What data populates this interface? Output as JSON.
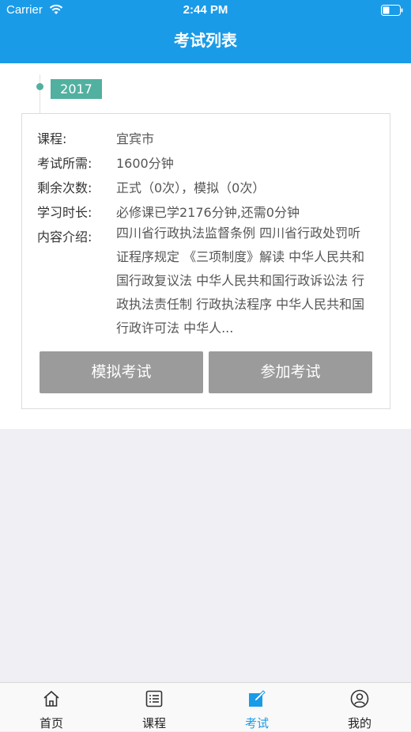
{
  "status_bar": {
    "carrier": "Carrier",
    "time": "2:44 PM"
  },
  "nav": {
    "title": "考试列表"
  },
  "timeline": {
    "year": "2017"
  },
  "exam": {
    "course_label": "课程:",
    "course_value": "宜宾市",
    "duration_label": "考试所需:",
    "duration_value": "1600分钟",
    "attempts_label": "剩余次数:",
    "attempts_value": "正式（0次），模拟（0次）",
    "study_label": "学习时长:",
    "study_value": "必修课已学2176分钟,还需0分钟",
    "intro_label": "内容介绍:",
    "intro_value": "四川省行政执法监督条例 四川省行政处罚听证程序规定 《三项制度》解读 中华人民共和国行政复议法 中华人民共和国行政诉讼法 行政执法责任制 行政执法程序 中华人民共和国行政许可法 中华人...",
    "sim_button": "模拟考试",
    "join_button": "参加考试"
  },
  "tabs": [
    {
      "label": "首页",
      "icon": "home-icon"
    },
    {
      "label": "课程",
      "icon": "list-icon"
    },
    {
      "label": "考试",
      "icon": "edit-icon",
      "active": true
    },
    {
      "label": "我的",
      "icon": "user-icon"
    }
  ],
  "colors": {
    "primary": "#1a9be8",
    "accent_teal": "#52b0a0",
    "button_gray": "#9b9b9b"
  }
}
